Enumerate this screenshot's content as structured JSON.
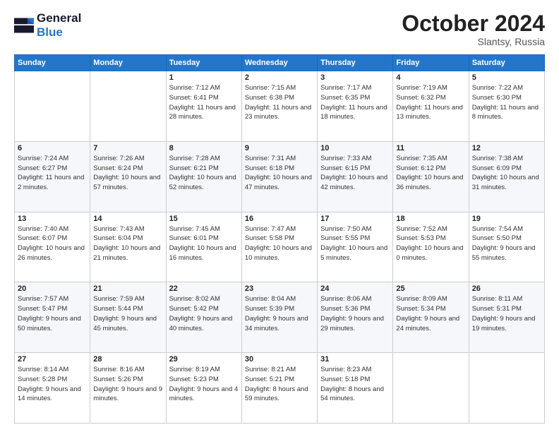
{
  "logo": {
    "line1": "General",
    "line2": "Blue"
  },
  "header": {
    "month": "October 2024",
    "location": "Slantsy, Russia"
  },
  "days_of_week": [
    "Sunday",
    "Monday",
    "Tuesday",
    "Wednesday",
    "Thursday",
    "Friday",
    "Saturday"
  ],
  "weeks": [
    [
      {
        "day": "",
        "info": ""
      },
      {
        "day": "",
        "info": ""
      },
      {
        "day": "1",
        "info": "Sunrise: 7:12 AM\nSunset: 6:41 PM\nDaylight: 11 hours\nand 28 minutes."
      },
      {
        "day": "2",
        "info": "Sunrise: 7:15 AM\nSunset: 6:38 PM\nDaylight: 11 hours\nand 23 minutes."
      },
      {
        "day": "3",
        "info": "Sunrise: 7:17 AM\nSunset: 6:35 PM\nDaylight: 11 hours\nand 18 minutes."
      },
      {
        "day": "4",
        "info": "Sunrise: 7:19 AM\nSunset: 6:32 PM\nDaylight: 11 hours\nand 13 minutes."
      },
      {
        "day": "5",
        "info": "Sunrise: 7:22 AM\nSunset: 6:30 PM\nDaylight: 11 hours\nand 8 minutes."
      }
    ],
    [
      {
        "day": "6",
        "info": "Sunrise: 7:24 AM\nSunset: 6:27 PM\nDaylight: 11 hours\nand 2 minutes."
      },
      {
        "day": "7",
        "info": "Sunrise: 7:26 AM\nSunset: 6:24 PM\nDaylight: 10 hours\nand 57 minutes."
      },
      {
        "day": "8",
        "info": "Sunrise: 7:28 AM\nSunset: 6:21 PM\nDaylight: 10 hours\nand 52 minutes."
      },
      {
        "day": "9",
        "info": "Sunrise: 7:31 AM\nSunset: 6:18 PM\nDaylight: 10 hours\nand 47 minutes."
      },
      {
        "day": "10",
        "info": "Sunrise: 7:33 AM\nSunset: 6:15 PM\nDaylight: 10 hours\nand 42 minutes."
      },
      {
        "day": "11",
        "info": "Sunrise: 7:35 AM\nSunset: 6:12 PM\nDaylight: 10 hours\nand 36 minutes."
      },
      {
        "day": "12",
        "info": "Sunrise: 7:38 AM\nSunset: 6:09 PM\nDaylight: 10 hours\nand 31 minutes."
      }
    ],
    [
      {
        "day": "13",
        "info": "Sunrise: 7:40 AM\nSunset: 6:07 PM\nDaylight: 10 hours\nand 26 minutes."
      },
      {
        "day": "14",
        "info": "Sunrise: 7:43 AM\nSunset: 6:04 PM\nDaylight: 10 hours\nand 21 minutes."
      },
      {
        "day": "15",
        "info": "Sunrise: 7:45 AM\nSunset: 6:01 PM\nDaylight: 10 hours\nand 16 minutes."
      },
      {
        "day": "16",
        "info": "Sunrise: 7:47 AM\nSunset: 5:58 PM\nDaylight: 10 hours\nand 10 minutes."
      },
      {
        "day": "17",
        "info": "Sunrise: 7:50 AM\nSunset: 5:55 PM\nDaylight: 10 hours\nand 5 minutes."
      },
      {
        "day": "18",
        "info": "Sunrise: 7:52 AM\nSunset: 5:53 PM\nDaylight: 10 hours\nand 0 minutes."
      },
      {
        "day": "19",
        "info": "Sunrise: 7:54 AM\nSunset: 5:50 PM\nDaylight: 9 hours\nand 55 minutes."
      }
    ],
    [
      {
        "day": "20",
        "info": "Sunrise: 7:57 AM\nSunset: 5:47 PM\nDaylight: 9 hours\nand 50 minutes."
      },
      {
        "day": "21",
        "info": "Sunrise: 7:59 AM\nSunset: 5:44 PM\nDaylight: 9 hours\nand 45 minutes."
      },
      {
        "day": "22",
        "info": "Sunrise: 8:02 AM\nSunset: 5:42 PM\nDaylight: 9 hours\nand 40 minutes."
      },
      {
        "day": "23",
        "info": "Sunrise: 8:04 AM\nSunset: 5:39 PM\nDaylight: 9 hours\nand 34 minutes."
      },
      {
        "day": "24",
        "info": "Sunrise: 8:06 AM\nSunset: 5:36 PM\nDaylight: 9 hours\nand 29 minutes."
      },
      {
        "day": "25",
        "info": "Sunrise: 8:09 AM\nSunset: 5:34 PM\nDaylight: 9 hours\nand 24 minutes."
      },
      {
        "day": "26",
        "info": "Sunrise: 8:11 AM\nSunset: 5:31 PM\nDaylight: 9 hours\nand 19 minutes."
      }
    ],
    [
      {
        "day": "27",
        "info": "Sunrise: 8:14 AM\nSunset: 5:28 PM\nDaylight: 9 hours\nand 14 minutes."
      },
      {
        "day": "28",
        "info": "Sunrise: 8:16 AM\nSunset: 5:26 PM\nDaylight: 9 hours\nand 9 minutes."
      },
      {
        "day": "29",
        "info": "Sunrise: 8:19 AM\nSunset: 5:23 PM\nDaylight: 9 hours\nand 4 minutes."
      },
      {
        "day": "30",
        "info": "Sunrise: 8:21 AM\nSunset: 5:21 PM\nDaylight: 8 hours\nand 59 minutes."
      },
      {
        "day": "31",
        "info": "Sunrise: 8:23 AM\nSunset: 5:18 PM\nDaylight: 8 hours\nand 54 minutes."
      },
      {
        "day": "",
        "info": ""
      },
      {
        "day": "",
        "info": ""
      }
    ]
  ]
}
